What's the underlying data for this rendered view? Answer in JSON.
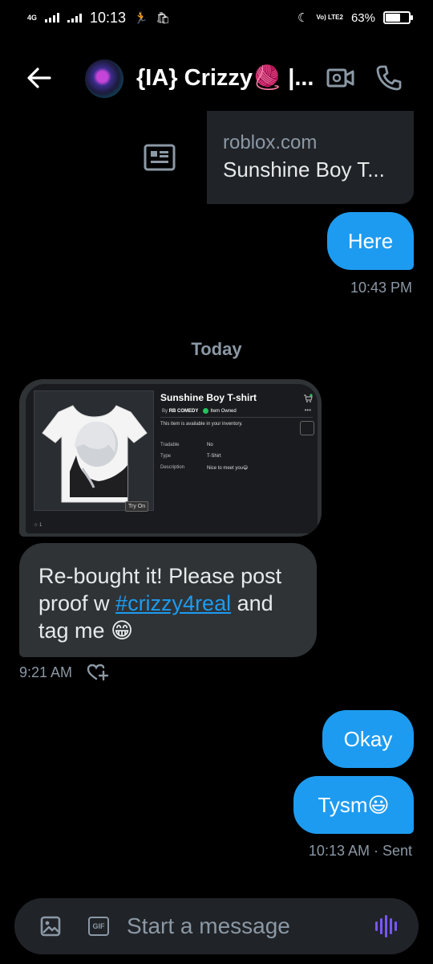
{
  "status_bar": {
    "network": "4G",
    "time": "10:13",
    "volte": "Vo) LTE2",
    "battery_percent": "63%",
    "battery_level": 0.63
  },
  "header": {
    "contact_name": "{IA} Crizzy🧶 |...",
    "back_icon": "arrow-left-icon",
    "video_icon": "video-call-icon",
    "call_icon": "phone-icon"
  },
  "link_preview": {
    "domain": "roblox.com",
    "title": "Sunshine Boy T...",
    "thumb_icon": "article-icon"
  },
  "messages": [
    {
      "id": "here",
      "direction": "outgoing",
      "text": "Here"
    },
    {
      "id": "okay",
      "direction": "outgoing",
      "text": "Okay"
    },
    {
      "id": "tysm",
      "direction": "outgoing",
      "text": "Tysm😃"
    }
  ],
  "timestamps": {
    "here": "10:43 PM",
    "incoming": "9:21 AM",
    "sent": "10:13 AM · Sent"
  },
  "day_separator": "Today",
  "product_screenshot": {
    "title": "Sunshine Boy T-shirt",
    "by_label": "By",
    "creator": "RB COMEDY",
    "owned": "Item Owned",
    "availability": "This item is available in your inventory.",
    "rows": [
      {
        "label": "Tradable",
        "value": "No"
      },
      {
        "label": "Type",
        "value": "T-Shirt"
      },
      {
        "label": "Description",
        "value": "Nice to meet you😃"
      }
    ],
    "try_on": "Try On",
    "footer": "1"
  },
  "incoming_message": {
    "before": "Re-bought it! Please post proof w ",
    "hashtag": "#crizzy4real",
    "after": " and tag me 😁"
  },
  "composer": {
    "placeholder": "Start a message",
    "gif_label": "GIF"
  },
  "colors": {
    "accent": "#1d9bf0",
    "incoming_bubble": "#2f3336",
    "voice": "#7856ff"
  }
}
